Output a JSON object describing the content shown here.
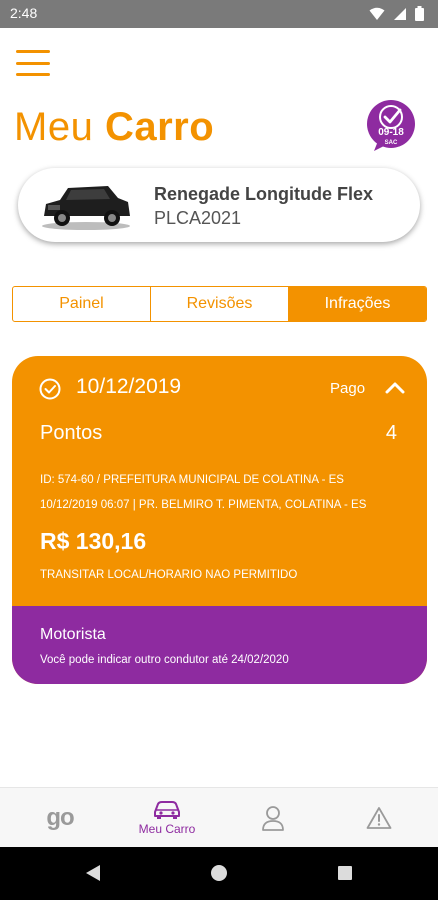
{
  "status_bar": {
    "time": "2:48"
  },
  "header": {
    "title_light": "Meu",
    "title_bold": "Carro",
    "sac_badge": {
      "hours": "09-18",
      "label": "SAC"
    }
  },
  "car": {
    "model": "Renegade Longitude Flex",
    "plate": "PLCA2021"
  },
  "tabs": [
    {
      "label": "Painel",
      "active": false
    },
    {
      "label": "Revisões",
      "active": false
    },
    {
      "label": "Infrações",
      "active": true
    }
  ],
  "infraction": {
    "date": "10/12/2019",
    "status": "Pago",
    "points_label": "Pontos",
    "points_value": "4",
    "line1": "ID: 574-60 / PREFEITURA MUNICIPAL DE COLATINA - ES",
    "line2": "10/12/2019 06:07 | PR. BELMIRO T. PIMENTA, COLATINA - ES",
    "amount": "R$ 130,16",
    "description": "TRANSITAR LOCAL/HORARIO NAO PERMITIDO",
    "driver_title": "Motorista",
    "driver_note": "Você pode indicar outro condutor até 24/02/2020"
  },
  "bottom_nav": {
    "go_label": "go",
    "car_label": "Meu Carro"
  },
  "colors": {
    "accent": "#f39200",
    "purple": "#8e2ba0",
    "nav_inactive": "#9a9a9a"
  }
}
